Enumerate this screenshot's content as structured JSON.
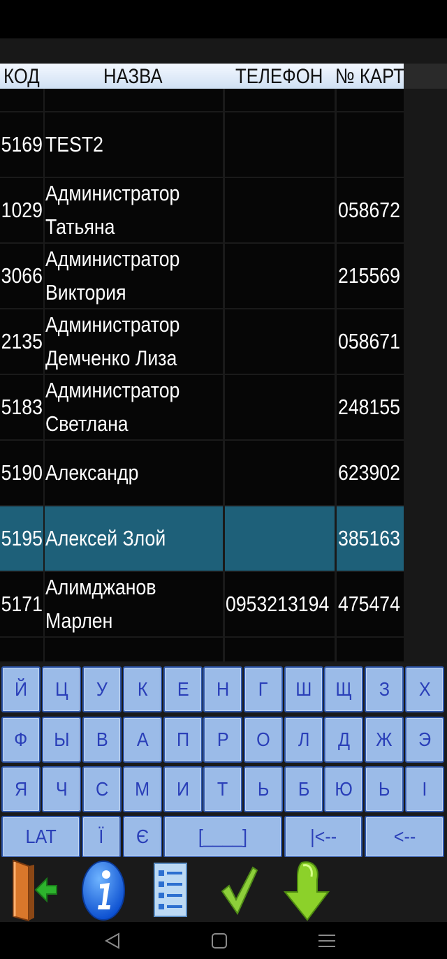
{
  "table": {
    "headers": [
      "КОД",
      "НАЗВА",
      "ТЕЛЕФОН",
      "№ КАРТИ"
    ],
    "rows": [
      {
        "code": "",
        "name": "",
        "phone": "",
        "card": ""
      },
      {
        "code": "5169",
        "name": "TEST2",
        "phone": "",
        "card": ""
      },
      {
        "code": "1029",
        "name": "Администратор Татьяна",
        "phone": "",
        "card": "058672"
      },
      {
        "code": "3066",
        "name": "Администратор Виктория",
        "phone": "",
        "card": "215569"
      },
      {
        "code": "2135",
        "name": "Администратор Демченко Лиза",
        "phone": "",
        "card": "058671"
      },
      {
        "code": "5183",
        "name": "Администратор Светлана",
        "phone": "",
        "card": "248155"
      },
      {
        "code": "5190",
        "name": "Александр",
        "phone": "",
        "card": "623902"
      },
      {
        "code": "5195",
        "name": "Алексей Злой",
        "phone": "",
        "card": "385163"
      },
      {
        "code": "5171",
        "name": "Алимджанов Марлен",
        "phone": "0953213194",
        "card": "475474"
      },
      {
        "code": "",
        "name": "",
        "phone": "",
        "card": ""
      }
    ],
    "selected_index": 7
  },
  "keyboard": {
    "row1": [
      "Й",
      "Ц",
      "У",
      "К",
      "Е",
      "Н",
      "Г",
      "Ш",
      "Щ",
      "З",
      "Х"
    ],
    "row2": [
      "Ф",
      "Ы",
      "В",
      "А",
      "П",
      "Р",
      "О",
      "Л",
      "Д",
      "Ж",
      "Э"
    ],
    "row3": [
      "Я",
      "Ч",
      "С",
      "М",
      "И",
      "Т",
      "Ь",
      "Б",
      "Ю",
      "Ь",
      "І"
    ],
    "row4": [
      "LAT",
      "Ї",
      "Є",
      "[____]",
      "|<--",
      "<--"
    ]
  },
  "toolbar": {
    "icons": [
      "exit-door-icon",
      "info-icon",
      "list-icon",
      "checkmark-icon",
      "down-arrow-icon"
    ]
  },
  "colors": {
    "selected_row": "#1e6079",
    "key_fill": "#9bbbe8",
    "key_text": "#2a3fb8"
  }
}
